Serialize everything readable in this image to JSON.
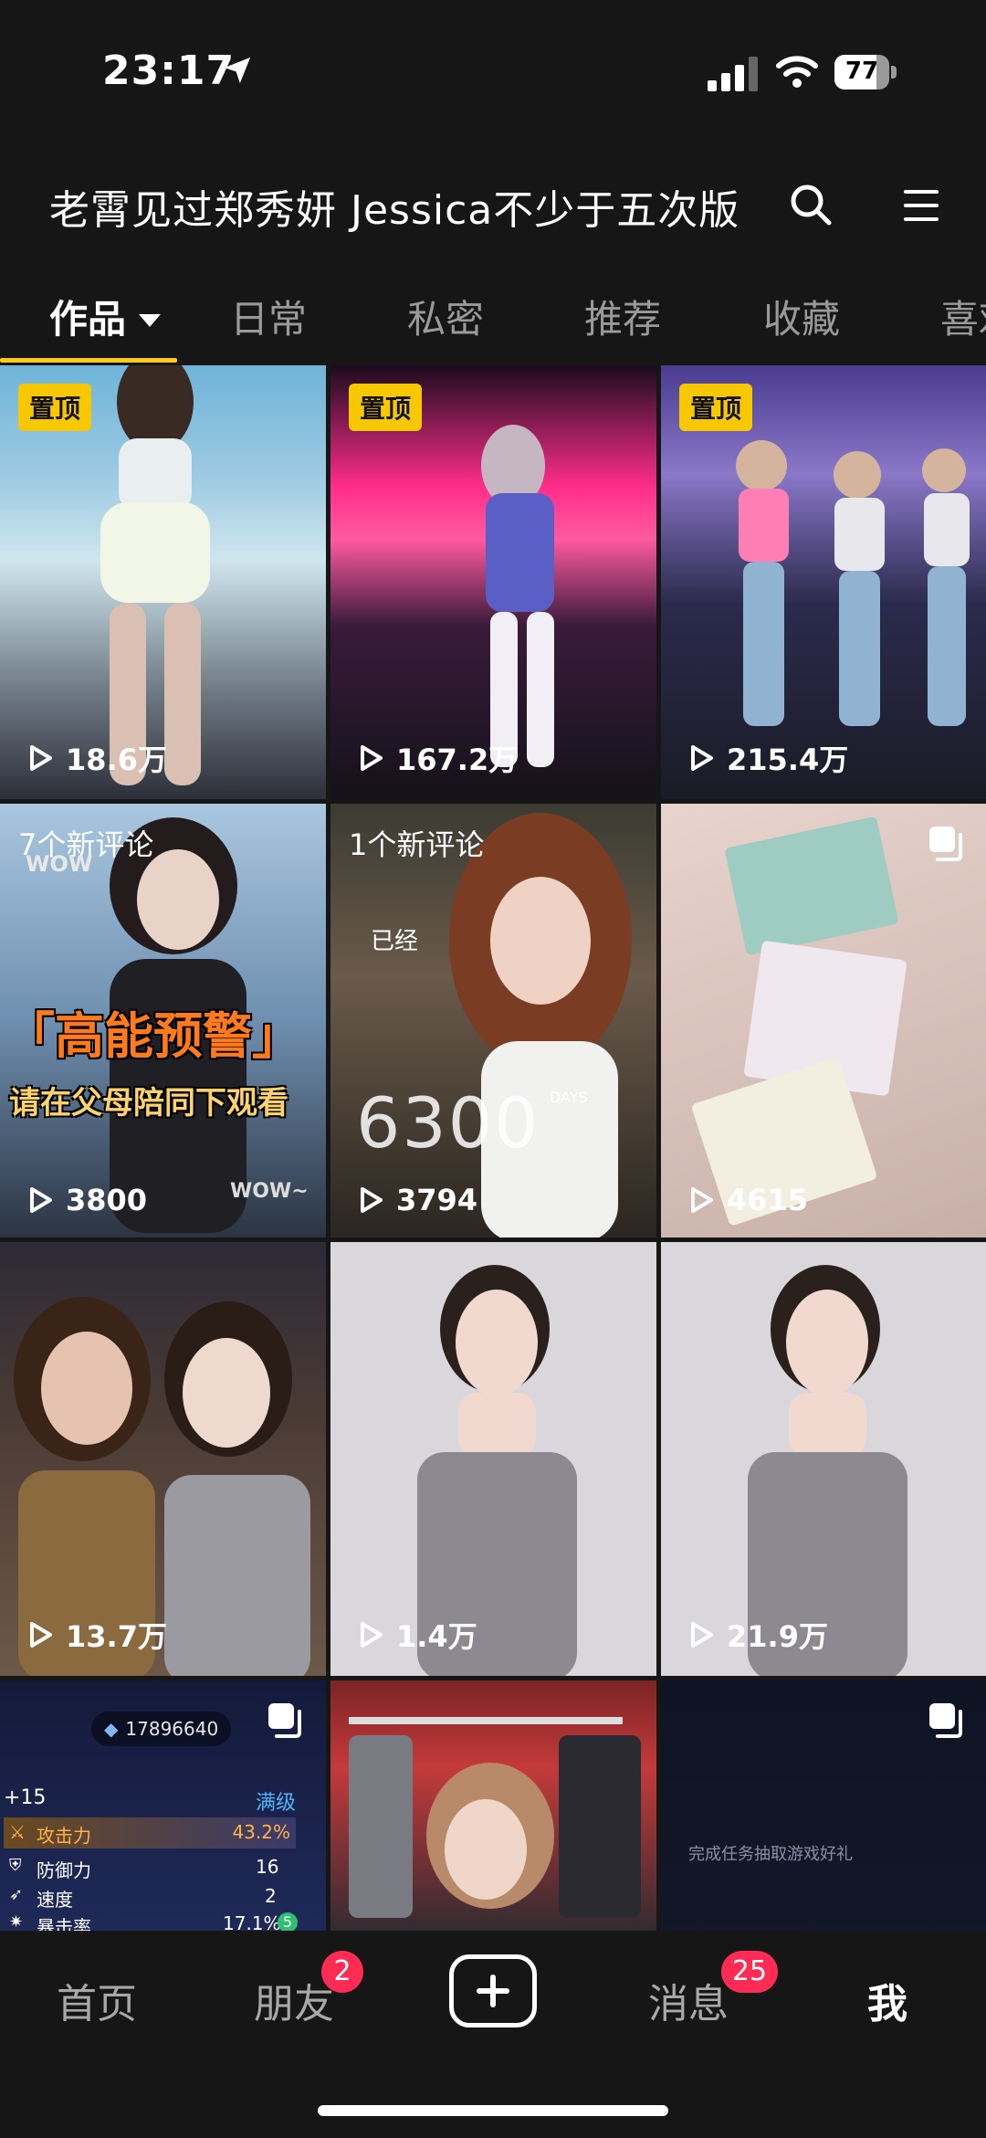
{
  "status_bar": {
    "time": "23:17",
    "battery": "77",
    "battery_level": 0.77
  },
  "header": {
    "title": "老霄见过郑秀妍 Jessica不少于五次版"
  },
  "tabs": [
    "作品",
    "日常",
    "私密",
    "推荐",
    "收藏",
    "喜欢"
  ],
  "grid": [
    {
      "badge": "置顶",
      "plays": "18.6万"
    },
    {
      "badge": "置顶",
      "plays": "167.2万"
    },
    {
      "badge": "置顶",
      "plays": "215.4万"
    },
    {
      "comments": "7个新评论",
      "plays": "3800",
      "overlay": {
        "title": "「高能预警」",
        "subtitle": "请在父母陪同下观看",
        "wow1": "WOW",
        "wow2": "WOW~"
      }
    },
    {
      "comments": "1个新评论",
      "plays": "3794",
      "overlay": {
        "already": "已经",
        "days_num": "6300",
        "days_label": "DAYS"
      }
    },
    {
      "multi": true,
      "plays": "4615"
    },
    {
      "plays": "13.7万"
    },
    {
      "plays": "1.4万"
    },
    {
      "plays": "21.9万"
    },
    {
      "multi": true,
      "game": {
        "id": "17896640",
        "plus": "+15",
        "max": "满级",
        "stats": [
          {
            "label": "攻击力",
            "value": "43.2%"
          },
          {
            "label": "防御力",
            "value": "16"
          },
          {
            "label": "速度",
            "value": "2"
          },
          {
            "label": "暴击率",
            "value": "17.1%",
            "bonus": "5"
          }
        ]
      }
    },
    {},
    {
      "multi": true,
      "task_text": "完成任务抽取游戏好礼"
    }
  ],
  "bottom_nav": {
    "items": [
      "首页",
      "朋友",
      "消息",
      "我"
    ],
    "friends_badge": "2",
    "messages_badge": "25"
  }
}
